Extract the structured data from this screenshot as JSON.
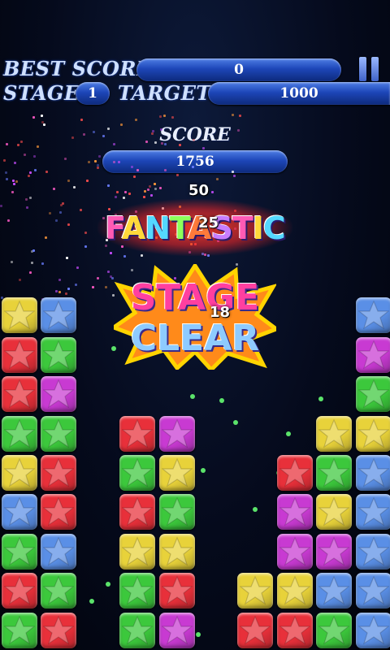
{
  "hud": {
    "best_score_label": "BEST SCORE",
    "best_score_value": "0",
    "stage_label": "STAGE",
    "stage_value": "1",
    "target_label": "TARGET",
    "target_value": "1000",
    "pause_icon": "pause-icon"
  },
  "score": {
    "label": "SCORE",
    "value": "1756"
  },
  "floating_points": [
    "50",
    "25",
    "18"
  ],
  "banners": {
    "fantastic": "FANTASTIC",
    "stage_clear_line1": "STAGE",
    "stage_clear_line2": "CLEAR"
  },
  "colors": {
    "red": "#e8303a",
    "green": "#3cc83c",
    "blue": "#5a8fe6",
    "yellow": "#e8d23a",
    "purple": "#c83ad2"
  },
  "board": {
    "columns": [
      [
        "G",
        "R",
        "G",
        "B",
        "Y",
        "G",
        "R",
        "R",
        "Y"
      ],
      [
        "R",
        "G",
        "B",
        "R",
        "R",
        "G",
        "P",
        "G",
        "B"
      ],
      [],
      [
        "G",
        "G",
        "Y",
        "R",
        "G",
        "R"
      ],
      [
        "P",
        "R",
        "Y",
        "G",
        "Y",
        "P"
      ],
      [],
      [
        "R",
        "Y"
      ],
      [
        "R",
        "Y",
        "P",
        "P",
        "R"
      ],
      [
        "G",
        "B",
        "P",
        "Y",
        "G",
        "Y"
      ],
      [
        "B",
        "B",
        "B",
        "B",
        "B",
        "Y",
        "G",
        "P",
        "B"
      ]
    ]
  }
}
